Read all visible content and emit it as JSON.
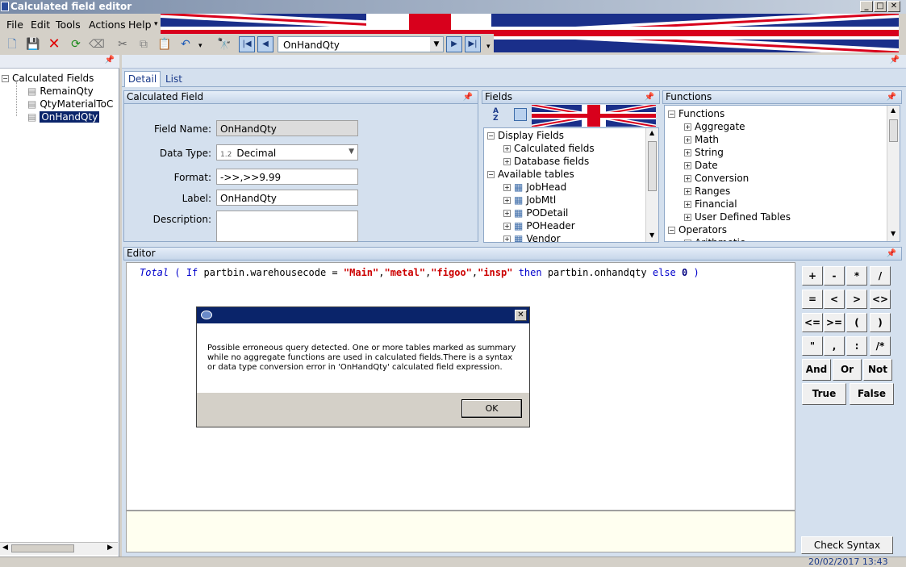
{
  "window": {
    "title": "Calculated field editor"
  },
  "menu": [
    "File",
    "Edit",
    "Tools",
    "Actions",
    "Help"
  ],
  "toolbar": {
    "field_combo_value": "OnHandQty"
  },
  "left_tree": {
    "root": "Calculated Fields",
    "items": [
      "RemainQty",
      "QtyMaterialToC",
      "OnHandQty"
    ],
    "selected": "OnHandQty"
  },
  "tabs": [
    "Detail",
    "List"
  ],
  "calc_field_panel": {
    "title": "Calculated Field",
    "field_name_label": "Field Name:",
    "field_name_value": "OnHandQty",
    "data_type_label": "Data Type:",
    "data_type_prefix": "1.2",
    "data_type_value": "Decimal",
    "format_label": "Format:",
    "format_value": "->>,>>9.99",
    "label_label": "Label:",
    "label_value": "OnHandQty",
    "description_label": "Description:",
    "description_value": ""
  },
  "fields_panel": {
    "title": "Fields",
    "sort_icon_text": "A Z",
    "tree": [
      {
        "label": "Display Fields",
        "level": 0,
        "expander": "-"
      },
      {
        "label": "Calculated fields",
        "level": 1,
        "expander": "+"
      },
      {
        "label": "Database fields",
        "level": 1,
        "expander": "+"
      },
      {
        "label": "Available tables",
        "level": 0,
        "expander": "-"
      },
      {
        "label": "JobHead",
        "level": 1,
        "expander": "+",
        "table": true
      },
      {
        "label": "JobMtl",
        "level": 1,
        "expander": "+",
        "table": true
      },
      {
        "label": "PODetail",
        "level": 1,
        "expander": "+",
        "table": true
      },
      {
        "label": "POHeader",
        "level": 1,
        "expander": "+",
        "table": true
      },
      {
        "label": "Vendor",
        "level": 1,
        "expander": "+",
        "table": true
      }
    ]
  },
  "functions_panel": {
    "title": "Functions",
    "tree": [
      {
        "label": "Functions",
        "level": 0,
        "expander": "-"
      },
      {
        "label": "Aggregate",
        "level": 1,
        "expander": "+"
      },
      {
        "label": "Math",
        "level": 1,
        "expander": "+"
      },
      {
        "label": "String",
        "level": 1,
        "expander": "+"
      },
      {
        "label": "Date",
        "level": 1,
        "expander": "+"
      },
      {
        "label": "Conversion",
        "level": 1,
        "expander": "+"
      },
      {
        "label": "Ranges",
        "level": 1,
        "expander": "+"
      },
      {
        "label": "Financial",
        "level": 1,
        "expander": "+"
      },
      {
        "label": "User Defined Tables",
        "level": 1,
        "expander": "+"
      },
      {
        "label": "Operators",
        "level": 0,
        "expander": "-"
      },
      {
        "label": "Arithmetic",
        "level": 1,
        "expander": "+"
      }
    ]
  },
  "editor": {
    "title": "Editor",
    "tokens": [
      {
        "t": "Total",
        "c": "#0000cc",
        "i": true
      },
      {
        "t": " ( ",
        "c": "#0000cc"
      },
      {
        "t": "If",
        "c": "#0000cc"
      },
      {
        "t": " partbin.warehousecode = ",
        "c": "#000000"
      },
      {
        "t": "\"Main\"",
        "c": "#cc0000",
        "b": true
      },
      {
        "t": ",",
        "c": "#000000"
      },
      {
        "t": "\"metal\"",
        "c": "#cc0000",
        "b": true
      },
      {
        "t": ",",
        "c": "#000000"
      },
      {
        "t": "\"figoo\"",
        "c": "#cc0000",
        "b": true
      },
      {
        "t": ",",
        "c": "#000000"
      },
      {
        "t": "\"insp\"",
        "c": "#cc0000",
        "b": true
      },
      {
        "t": " then ",
        "c": "#0000cc"
      },
      {
        "t": "partbin.onhandqty",
        "c": "#000000"
      },
      {
        "t": " else ",
        "c": "#0000cc"
      },
      {
        "t": "0",
        "c": "#000080",
        "b": true
      },
      {
        "t": " )",
        "c": "#0000cc"
      }
    ]
  },
  "keypad": {
    "rows": [
      [
        "+",
        "-",
        "*",
        "/"
      ],
      [
        "=",
        "<",
        ">",
        "<>"
      ],
      [
        "<=",
        ">=",
        "(",
        ")"
      ],
      [
        "\"",
        ",",
        ":",
        "/*"
      ]
    ],
    "logic": [
      "And",
      "Or",
      "Not"
    ],
    "bool": [
      "True",
      "False"
    ],
    "check_syntax": "Check Syntax"
  },
  "dialog": {
    "message": "Possible erroneous query detected. One or more tables marked as summary while no aggregate functions are used in calculated fields.There is a syntax or data type conversion error in 'OnHandQty' calculated field expression.",
    "ok": "OK"
  },
  "status": {
    "datetime": "20/02/2017  13:43"
  },
  "colors": {
    "flag_blue": "#1a2f8a",
    "flag_red": "#d8001c",
    "accent": "#0a246a"
  }
}
